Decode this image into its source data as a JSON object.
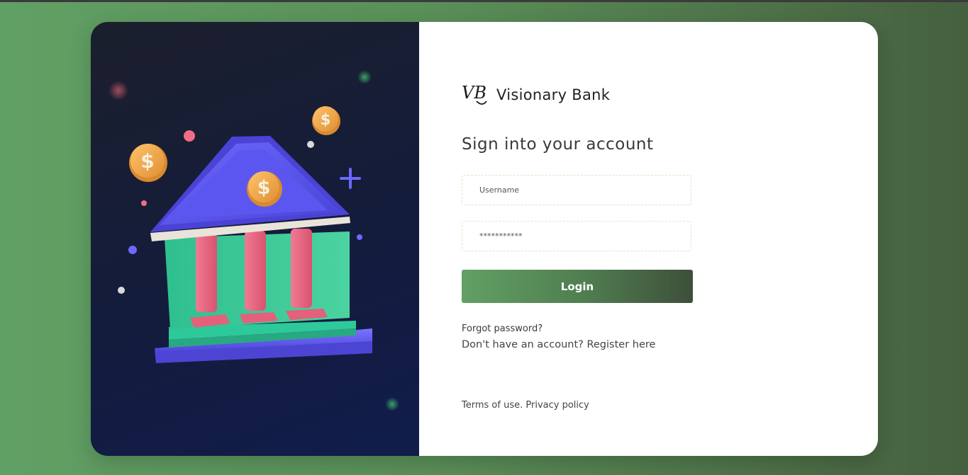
{
  "brand": {
    "logo_text": "VB",
    "name": "Visionary Bank"
  },
  "form": {
    "heading": "Sign into your account",
    "username_placeholder": "Username",
    "password_value": "***********",
    "login_label": "Login"
  },
  "links": {
    "forgot_password": "Forgot password?",
    "no_account_text": "Don't have an account?",
    "register_link": "Register here",
    "terms": "Terms of use.",
    "privacy": "Privacy policy"
  },
  "illustration": {
    "coin_symbol": "$"
  },
  "colors": {
    "accent_green": "#62a064",
    "accent_dark": "#3e4f3a",
    "panel_dark": "#141c3c"
  }
}
